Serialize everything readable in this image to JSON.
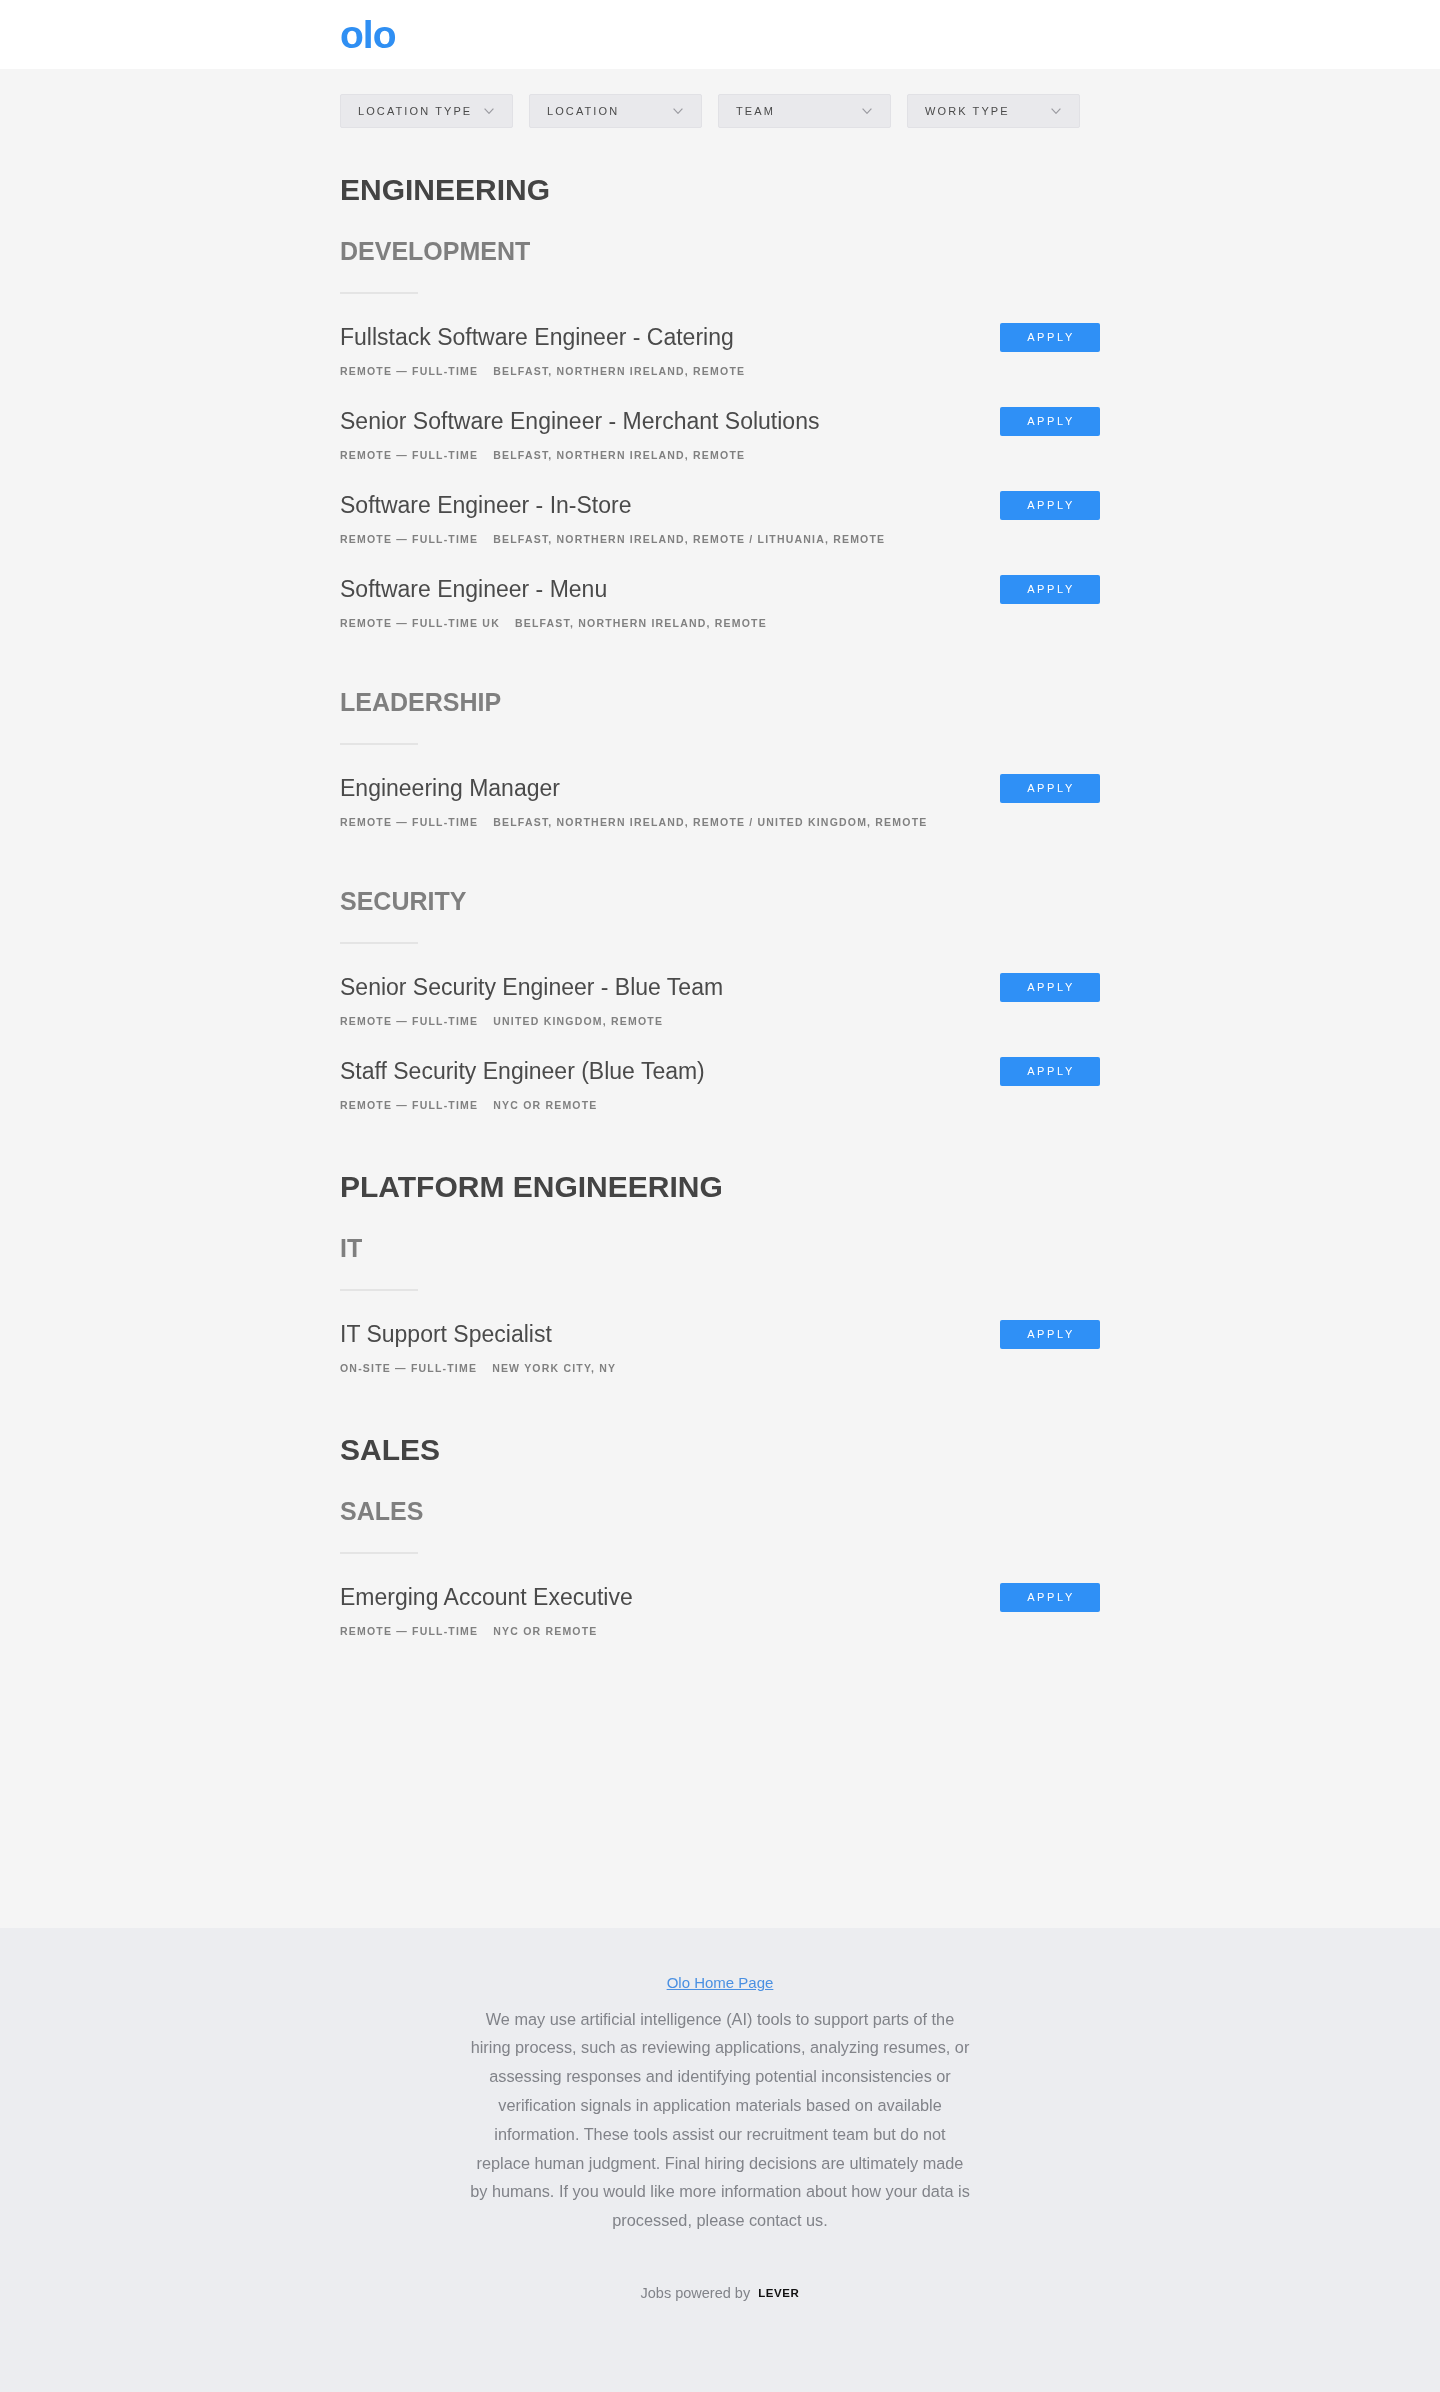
{
  "header": {
    "logo": "olo"
  },
  "filters": [
    {
      "label": "LOCATION TYPE"
    },
    {
      "label": "LOCATION"
    },
    {
      "label": "TEAM"
    },
    {
      "label": "WORK TYPE"
    }
  ],
  "departments": [
    {
      "name": "ENGINEERING",
      "teams": [
        {
          "name": "DEVELOPMENT",
          "postings": [
            {
              "title": "Fullstack Software Engineer - Catering",
              "commitment": "REMOTE — FULL-TIME",
              "location": "BELFAST, NORTHERN IRELAND, REMOTE",
              "apply": "APPLY"
            },
            {
              "title": "Senior Software Engineer - Merchant Solutions",
              "commitment": "REMOTE — FULL-TIME",
              "location": "BELFAST, NORTHERN IRELAND, REMOTE",
              "apply": "APPLY"
            },
            {
              "title": "Software Engineer - In-Store",
              "commitment": "REMOTE — FULL-TIME",
              "location": "BELFAST, NORTHERN IRELAND, REMOTE / LITHUANIA, REMOTE",
              "apply": "APPLY"
            },
            {
              "title": "Software Engineer - Menu",
              "commitment": "REMOTE — FULL-TIME UK",
              "location": "BELFAST, NORTHERN IRELAND, REMOTE",
              "apply": "APPLY"
            }
          ]
        },
        {
          "name": "LEADERSHIP",
          "postings": [
            {
              "title": "Engineering Manager",
              "commitment": "REMOTE — FULL-TIME",
              "location": "BELFAST, NORTHERN IRELAND, REMOTE / UNITED KINGDOM, REMOTE",
              "apply": "APPLY"
            }
          ]
        },
        {
          "name": "SECURITY",
          "postings": [
            {
              "title": "Senior Security Engineer - Blue Team",
              "commitment": "REMOTE — FULL-TIME",
              "location": "UNITED KINGDOM, REMOTE",
              "apply": "APPLY"
            },
            {
              "title": "Staff Security Engineer (Blue Team)",
              "commitment": "REMOTE — FULL-TIME",
              "location": "NYC OR REMOTE",
              "apply": "APPLY"
            }
          ]
        }
      ]
    },
    {
      "name": "PLATFORM ENGINEERING",
      "teams": [
        {
          "name": "IT",
          "postings": [
            {
              "title": "IT Support Specialist",
              "commitment": "ON-SITE — FULL-TIME",
              "location": "NEW YORK CITY, NY",
              "apply": "APPLY"
            }
          ]
        }
      ]
    },
    {
      "name": "SALES",
      "teams": [
        {
          "name": "SALES",
          "postings": [
            {
              "title": "Emerging Account Executive",
              "commitment": "REMOTE — FULL-TIME",
              "location": "NYC OR REMOTE",
              "apply": "APPLY"
            }
          ]
        }
      ]
    }
  ],
  "footer": {
    "link": "Olo Home Page",
    "notice": "We may use artificial intelligence (AI) tools to support parts of the hiring process, such as reviewing applications, analyzing resumes, or assessing responses and identifying potential inconsistencies or verification signals in application materials based on available information. These tools assist our recruitment team but do not replace human judgment. Final hiring decisions are ultimately made by humans. If you would like more information about how your data is processed, please contact us.",
    "powered_by": "Jobs powered by",
    "brand": "LEVER"
  }
}
